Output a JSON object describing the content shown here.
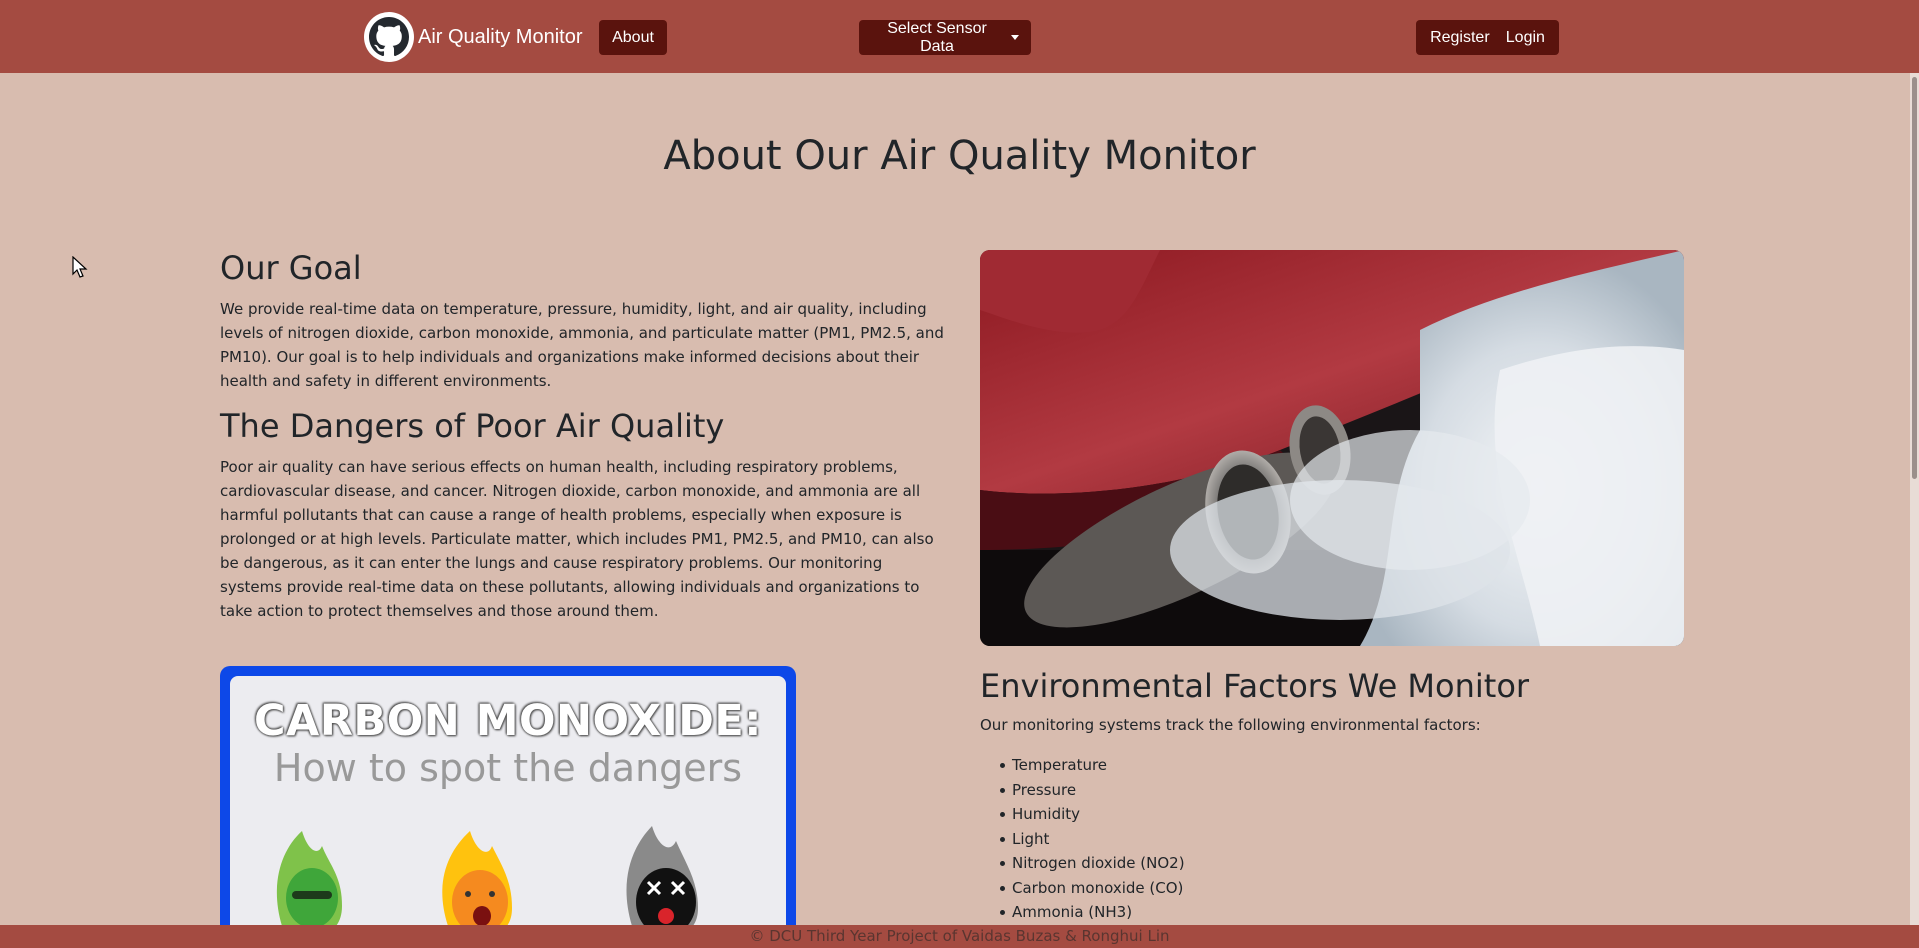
{
  "nav": {
    "brand": "Air Quality Monitor",
    "about": "About",
    "sensor_dropdown": "Select Sensor Data",
    "register": "Register",
    "login": "Login"
  },
  "page": {
    "title": "About Our Air Quality Monitor"
  },
  "goal": {
    "heading": "Our Goal",
    "text": "We provide real-time data on temperature, pressure, humidity, light, and air quality, including levels of nitrogen dioxide, carbon monoxide, ammonia, and particulate matter (PM1, PM2.5, and PM10). Our goal is to help individuals and organizations make informed decisions about their health and safety in different environments."
  },
  "dangers": {
    "heading": "The Dangers of Poor Air Quality",
    "text": "Poor air quality can have serious effects on human health, including respiratory problems, cardiovascular disease, and cancer. Nitrogen dioxide, carbon monoxide, and ammonia are all harmful pollutants that can cause a range of health problems, especially when exposure is prolonged or at high levels. Particulate matter, which includes PM1, PM2.5, and PM10, can also be dangerous, as it can enter the lungs and cause respiratory problems. Our monitoring systems provide real-time data on these pollutants, allowing individuals and organizations to take action to protect themselves and those around them."
  },
  "environment": {
    "heading": "Environmental Factors We Monitor",
    "intro": "Our monitoring systems track the following environmental factors:",
    "factors": [
      "Temperature",
      "Pressure",
      "Humidity",
      "Light",
      "Nitrogen dioxide (NO2)",
      "Carbon monoxide (CO)",
      "Ammonia (NH3)"
    ]
  },
  "infographic": {
    "title": "CARBON MONOXIDE:",
    "subtitle": "How to spot the dangers"
  },
  "footer": {
    "text": "© DCU Third Year Project of Vaidas Buzas & Ronghui Lin"
  },
  "colors": {
    "navbar": "#a44b41",
    "background": "#d8bcaf",
    "button": "#5a130d",
    "infographic_border": "#0d48e8"
  }
}
